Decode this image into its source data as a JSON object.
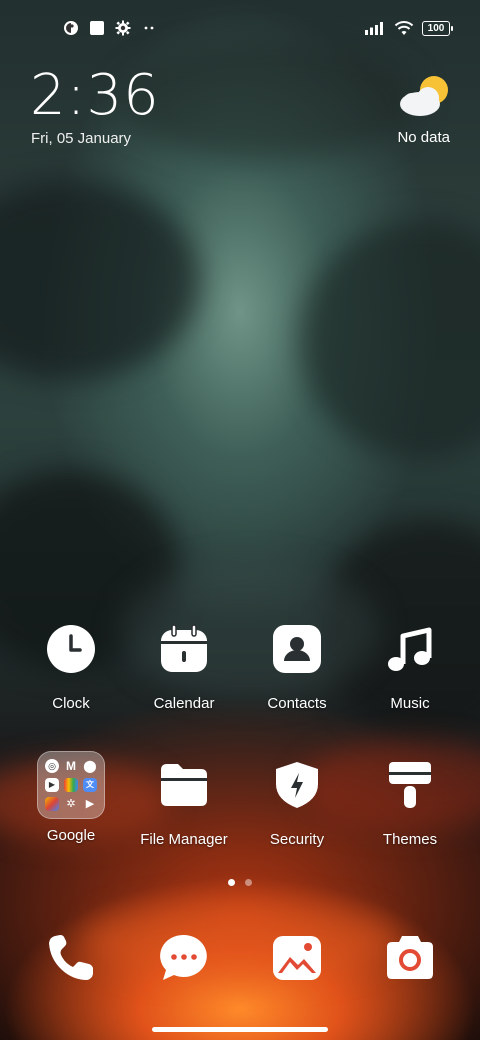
{
  "status_bar": {
    "left_icons": [
      "data-saver-icon",
      "square-icon",
      "settings-icon",
      "more-dots-icon"
    ],
    "right_icons": [
      "signal-icon",
      "wifi-icon",
      "battery-icon"
    ],
    "battery": "100"
  },
  "clock": {
    "time": "2:36",
    "date": "Fri, 05 January"
  },
  "weather": {
    "icon": "partly-cloudy-icon",
    "text": "No data"
  },
  "apps_row1": [
    {
      "label": "Clock",
      "icon": "clock-icon"
    },
    {
      "label": "Calendar",
      "icon": "calendar-icon"
    },
    {
      "label": "Contacts",
      "icon": "contacts-icon"
    },
    {
      "label": "Music",
      "icon": "music-icon"
    }
  ],
  "apps_row2": [
    {
      "label": "Google",
      "icon": "google-folder-icon"
    },
    {
      "label": "File Manager",
      "icon": "folder-icon"
    },
    {
      "label": "Security",
      "icon": "shield-icon"
    },
    {
      "label": "Themes",
      "icon": "paint-roller-icon"
    }
  ],
  "pager": {
    "pages": 2,
    "current": 1
  },
  "dock": [
    {
      "icon": "phone-icon"
    },
    {
      "icon": "messages-icon"
    },
    {
      "icon": "gallery-icon"
    },
    {
      "icon": "camera-icon"
    }
  ],
  "colors": {
    "accent_red": "#e24a33",
    "icon_white": "#ffffff"
  }
}
